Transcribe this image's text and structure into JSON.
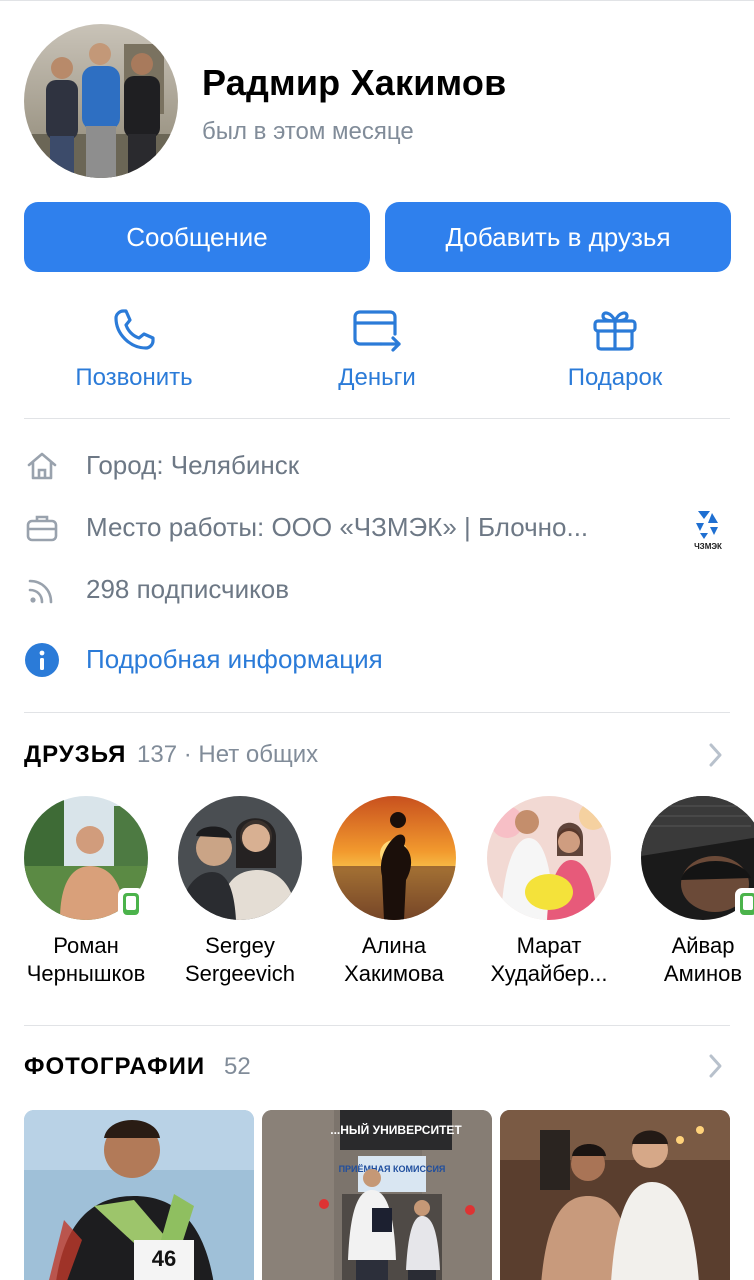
{
  "profile": {
    "name": "Радмир Хакимов",
    "status": "был в этом месяце"
  },
  "buttons": {
    "message": "Сообщение",
    "add_friend": "Добавить в друзья"
  },
  "actions": {
    "call": "Позвонить",
    "money": "Деньги",
    "gift": "Подарок"
  },
  "info": {
    "city": "Город: Челябинск",
    "work": "Место работы: ООО «ЧЗМЭК» | Блочно...",
    "followers": "298 подписчиков",
    "details_link": "Подробная информация",
    "work_logo_text": "ЧЗМЭК"
  },
  "friends": {
    "title": "ДРУЗЬЯ",
    "meta": "137 · Нет общих",
    "items": [
      {
        "first": "Роман",
        "last": "Чернышков",
        "mobile": true
      },
      {
        "first": "Sergey",
        "last": "Sergeevich",
        "mobile": false
      },
      {
        "first": "Алина",
        "last": "Хакимова",
        "mobile": false
      },
      {
        "first": "Марат",
        "last": "Худайбер...",
        "mobile": false
      },
      {
        "first": "Айвар",
        "last": "Аминов",
        "mobile": true
      }
    ]
  },
  "photos": {
    "title": "ФОТОГРАФИИ",
    "count": "52",
    "sign_university": "...НЫЙ УНИВЕРСИТЕТ",
    "sign_admission": "ПРИЁМНАЯ КОМИССИЯ",
    "bib_number": "46"
  },
  "colors": {
    "accent": "#2f80ed",
    "link": "#2b7bd8",
    "secondary_text": "#818c99",
    "icon_gray": "#99a2ad",
    "online_mobile": "#4bb34b"
  }
}
